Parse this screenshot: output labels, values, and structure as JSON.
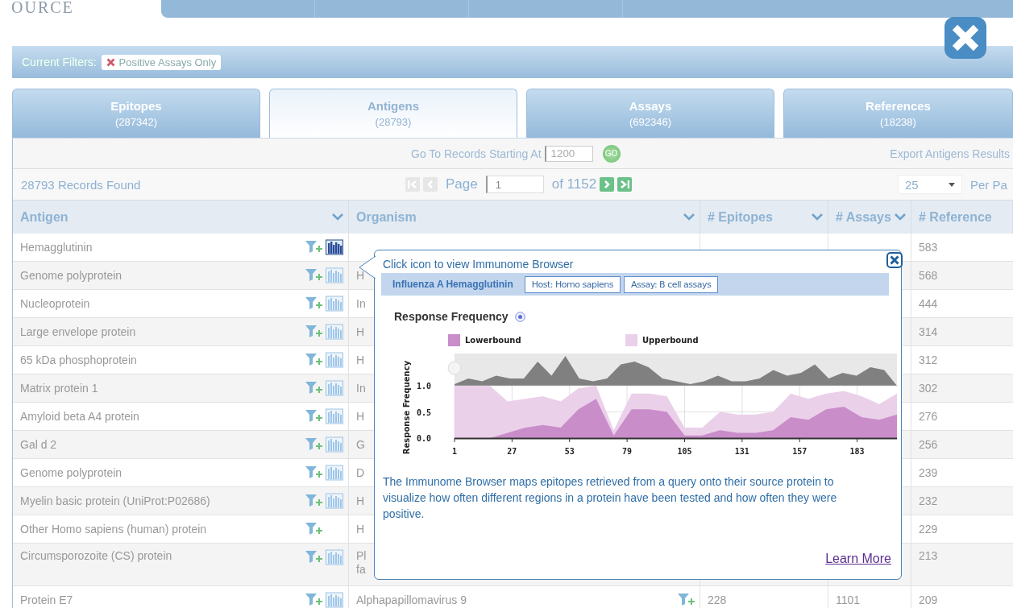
{
  "logo": {
    "text": "OURCE"
  },
  "filters": {
    "label": "Current Filters:",
    "chips": [
      "Positive Assays Only"
    ]
  },
  "tabs": [
    {
      "label": "Epitopes",
      "count": "(287342)",
      "selected": false
    },
    {
      "label": "Antigens",
      "count": "(28793)",
      "selected": true
    },
    {
      "label": "Assays",
      "count": "(692346)",
      "selected": false
    },
    {
      "label": "References",
      "count": "(18238)",
      "selected": false
    }
  ],
  "goto": {
    "label": "Go To Records Starting At",
    "value": "1200",
    "button": "GO",
    "export": "Export Antigens Results"
  },
  "pager": {
    "found": "28793 Records Found",
    "page_label": "Page",
    "page": "1",
    "of": "of 1152",
    "per_page": "25",
    "per_page_label": "Per Pa"
  },
  "table": {
    "columns": [
      {
        "label": "Antigen",
        "sort_caret": true
      },
      {
        "label": "Organism",
        "sort_caret": true
      },
      {
        "label": "# Epitopes",
        "sort_caret": true
      },
      {
        "label": "# Assays",
        "sort_caret": true
      },
      {
        "label": "# Reference",
        "sort_caret": false
      }
    ],
    "rows": [
      {
        "antigen": "Hemagglutinin",
        "chart_icon": true,
        "chart_active": true,
        "organism": "",
        "organism_filter": false,
        "references": "583"
      },
      {
        "antigen": "Genome polyprotein",
        "chart_icon": true,
        "chart_active": false,
        "organism": "H",
        "organism_filter": false,
        "references": "568"
      },
      {
        "antigen": "Nucleoprotein",
        "chart_icon": true,
        "chart_active": false,
        "organism": "In",
        "organism_filter": false,
        "references": "444"
      },
      {
        "antigen": "Large envelope protein",
        "chart_icon": true,
        "chart_active": false,
        "organism": "H",
        "organism_filter": false,
        "references": "314"
      },
      {
        "antigen": "65 kDa phosphoprotein",
        "chart_icon": true,
        "chart_active": false,
        "organism": "H",
        "organism_filter": false,
        "references": "312"
      },
      {
        "antigen": "Matrix protein 1",
        "chart_icon": true,
        "chart_active": false,
        "organism": "In",
        "organism_filter": false,
        "references": "302"
      },
      {
        "antigen": "Amyloid beta A4 protein",
        "chart_icon": true,
        "chart_active": false,
        "organism": "H",
        "organism_filter": false,
        "references": "276"
      },
      {
        "antigen": "Gal d 2",
        "chart_icon": true,
        "chart_active": false,
        "organism": "G",
        "organism_filter": false,
        "references": "256"
      },
      {
        "antigen": "Genome polyprotein",
        "chart_icon": true,
        "chart_active": false,
        "organism": "D",
        "organism_filter": false,
        "references": "239"
      },
      {
        "antigen": "Myelin basic protein (UniProt:P02686)",
        "chart_icon": true,
        "chart_active": false,
        "organism": "H",
        "organism_filter": false,
        "references": "232"
      },
      {
        "antigen": "Other Homo sapiens (human) protein",
        "chart_icon": false,
        "organism": "H",
        "organism_filter": false,
        "references": "229"
      },
      {
        "antigen": "Circumsporozoite (CS) protein",
        "chart_icon": true,
        "chart_active": false,
        "organism": "Pl\nfa",
        "organism_filter": false,
        "references": "213"
      },
      {
        "antigen": "Protein E7",
        "chart_icon": true,
        "chart_active": false,
        "organism": "Alphapapillomavirus 9",
        "organism_filter": true,
        "epitopes": "228",
        "assays": "1101",
        "references": "209"
      }
    ]
  },
  "popover": {
    "hint": "Click icon to view Immunome Browser",
    "protein": "Influenza A Hemagglutinin",
    "chips": [
      "Host: Homo sapiens",
      "Assay: B cell assays"
    ],
    "heading": "Response Frequency",
    "chart_data": {
      "type": "area",
      "grid": true,
      "ylabel": "Response Frequency",
      "x": [
        1,
        9,
        17,
        25,
        33,
        41,
        49,
        57,
        65,
        73,
        81,
        89,
        97,
        105,
        113,
        121,
        129,
        137,
        145,
        153,
        161,
        169,
        177,
        185,
        193,
        201
      ],
      "xlim": [
        1,
        201
      ],
      "ylim": [
        0,
        1
      ],
      "xticks": [
        1,
        27,
        53,
        79,
        105,
        131,
        157,
        183
      ],
      "yticks": [
        {
          "value": 0,
          "label": "0.0"
        },
        {
          "value": 0.5,
          "label": "0.5"
        },
        {
          "value": 1,
          "label": "1.0"
        }
      ],
      "series": [
        {
          "name": "Upperbound",
          "color": "#ebd0ea",
          "values": [
            1,
            1,
            1,
            0.7,
            0.75,
            0.8,
            0.7,
            0.95,
            1,
            0.15,
            0.85,
            0.85,
            0.8,
            0.2,
            0.2,
            0.5,
            0.45,
            0.45,
            0.5,
            0.85,
            0.75,
            0.85,
            0.9,
            0.8,
            0.65,
            0.85
          ]
        },
        {
          "name": "Lowerbound",
          "color": "#c98dc9",
          "values": [
            0,
            0,
            0,
            0.1,
            0.2,
            0.25,
            0.2,
            0.55,
            0.75,
            0.05,
            0.55,
            0.55,
            0.5,
            0.05,
            0.05,
            0.15,
            0.1,
            0.1,
            0.15,
            0.4,
            0.35,
            0.55,
            0.6,
            0.4,
            0.35,
            0.45
          ]
        }
      ]
    },
    "description": "The Immunome Browser maps epitopes retrieved from a query onto their source protein to visualize how often different regions in a protein have been tested and how often they were positive.",
    "link": "Learn More"
  }
}
